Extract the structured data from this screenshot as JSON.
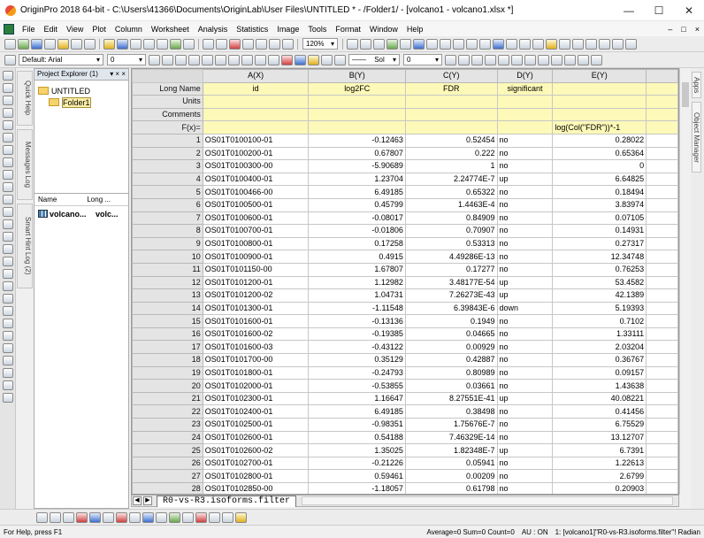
{
  "window": {
    "title": "OriginPro 2018 64-bit - C:\\Users\\41366\\Documents\\OriginLab\\User Files\\UNTITLED * - /Folder1/ - [volcano1 - volcano1.xlsx *]"
  },
  "menu": [
    "File",
    "Edit",
    "View",
    "Plot",
    "Column",
    "Worksheet",
    "Analysis",
    "Statistics",
    "Image",
    "Tools",
    "Format",
    "Window",
    "Help"
  ],
  "toolbar": {
    "zoom": "120%",
    "font": "Default: Arial",
    "font_size": "0",
    "line_style": "Sol",
    "line_width": "0"
  },
  "side_tabs": [
    "Quick Help",
    "Messages Log",
    "Smart Hint Log (2)"
  ],
  "right_tabs": [
    "Apps",
    "Object Manager"
  ],
  "project_explorer": {
    "title": "Project Explorer (1)",
    "controls": "▾ × ×",
    "root": "UNTITLED",
    "folder": "Folder1",
    "col_name": "Name",
    "col_long": "Long ...",
    "items": [
      {
        "name": "volcano...",
        "long": "volc..."
      }
    ]
  },
  "sheet": {
    "columns": [
      "A(X)",
      "B(Y)",
      "C(Y)",
      "D(Y)",
      "E(Y)"
    ],
    "meta_labels": [
      "Long Name",
      "Units",
      "Comments",
      "F(x)="
    ],
    "long_names": [
      "id",
      "log2FC",
      "FDR",
      "significant",
      ""
    ],
    "fx": [
      "",
      "",
      "",
      "",
      "log(Col(\"FDR\"))*-1"
    ],
    "rows": [
      [
        "1",
        "OS01T0100100-01",
        "-0.12463",
        "0.52454",
        "no",
        "0.28022"
      ],
      [
        "2",
        "OS01T0100200-01",
        "0.67807",
        "0.222",
        "no",
        "0.65364"
      ],
      [
        "3",
        "OS01T0100300-00",
        "-5.90689",
        "1",
        "no",
        "0"
      ],
      [
        "4",
        "OS01T0100400-01",
        "1.23704",
        "2.24774E-7",
        "up",
        "6.64825"
      ],
      [
        "5",
        "OS01T0100466-00",
        "6.49185",
        "0.65322",
        "no",
        "0.18494"
      ],
      [
        "6",
        "OS01T0100500-01",
        "0.45799",
        "1.4463E-4",
        "no",
        "3.83974"
      ],
      [
        "7",
        "OS01T0100600-01",
        "-0.08017",
        "0.84909",
        "no",
        "0.07105"
      ],
      [
        "8",
        "OS01T0100700-01",
        "-0.01806",
        "0.70907",
        "no",
        "0.14931"
      ],
      [
        "9",
        "OS01T0100800-01",
        "0.17258",
        "0.53313",
        "no",
        "0.27317"
      ],
      [
        "10",
        "OS01T0100900-01",
        "0.4915",
        "4.49286E-13",
        "no",
        "12.34748"
      ],
      [
        "11",
        "OS01T0101150-00",
        "1.67807",
        "0.17277",
        "no",
        "0.76253"
      ],
      [
        "12",
        "OS01T0101200-01",
        "1.12982",
        "3.48177E-54",
        "up",
        "53.4582"
      ],
      [
        "13",
        "OS01T0101200-02",
        "1.04731",
        "7.26273E-43",
        "up",
        "42.1389"
      ],
      [
        "14",
        "OS01T0101300-01",
        "-1.11548",
        "6.39843E-6",
        "down",
        "5.19393"
      ],
      [
        "15",
        "OS01T0101600-01",
        "-0.13136",
        "0.1949",
        "no",
        "0.7102"
      ],
      [
        "16",
        "OS01T0101600-02",
        "-0.19385",
        "0.04665",
        "no",
        "1.33111"
      ],
      [
        "17",
        "OS01T0101600-03",
        "-0.43122",
        "0.00929",
        "no",
        "2.03204"
      ],
      [
        "18",
        "OS01T0101700-00",
        "0.35129",
        "0.42887",
        "no",
        "0.36767"
      ],
      [
        "19",
        "OS01T0101800-01",
        "-0.24793",
        "0.80989",
        "no",
        "0.09157"
      ],
      [
        "20",
        "OS01T0102000-01",
        "-0.53855",
        "0.03661",
        "no",
        "1.43638"
      ],
      [
        "21",
        "OS01T0102300-01",
        "1.16647",
        "8.27551E-41",
        "up",
        "40.08221"
      ],
      [
        "22",
        "OS01T0102400-01",
        "6.49185",
        "0.38498",
        "no",
        "0.41456"
      ],
      [
        "23",
        "OS01T0102500-01",
        "-0.98351",
        "1.75676E-7",
        "no",
        "6.75529"
      ],
      [
        "24",
        "OS01T0102600-01",
        "0.54188",
        "7.46329E-14",
        "no",
        "13.12707"
      ],
      [
        "25",
        "OS01T0102600-02",
        "1.35025",
        "1.82348E-7",
        "up",
        "6.7391"
      ],
      [
        "26",
        "OS01T0102700-01",
        "-0.21226",
        "0.05941",
        "no",
        "1.22613"
      ],
      [
        "27",
        "OS01T0102800-01",
        "0.59461",
        "0.00209",
        "no",
        "2.6799"
      ],
      [
        "28",
        "OS01T0102850-00",
        "-1.18057",
        "0.61798",
        "no",
        "0.20903"
      ]
    ]
  },
  "sheet_tab": "R0-vs-R3.isoforms.filter",
  "status": {
    "help": "For Help, press F1",
    "stats": "Average=0 Sum=0 Count=0",
    "units": "AU : ON",
    "info": "1: [volcano1]\"R0-vs-R3.isoforms.filter\"! Radian"
  }
}
